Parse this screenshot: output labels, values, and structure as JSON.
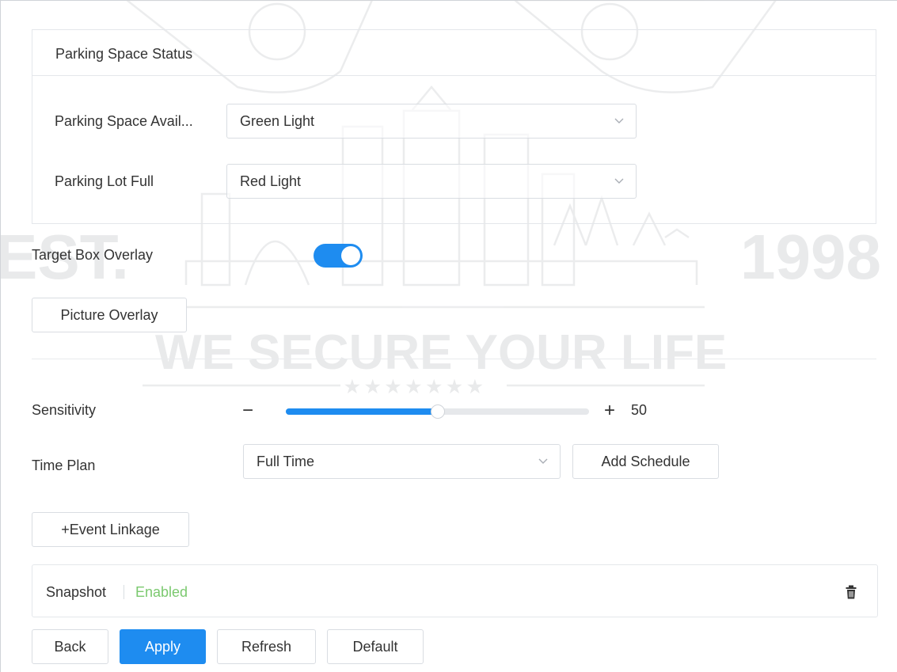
{
  "parking_status": {
    "title": "Parking Space Status",
    "available_label": "Parking Space Avail...",
    "available_value": "Green Light",
    "full_label": "Parking Lot Full",
    "full_value": "Red Light"
  },
  "target_box_overlay": {
    "label": "Target Box Overlay",
    "enabled": true
  },
  "picture_overlay_button": "Picture Overlay",
  "sensitivity": {
    "label": "Sensitivity",
    "minus": "−",
    "plus": "+",
    "value": "50",
    "level": 0.5
  },
  "time_plan": {
    "label": "Time Plan",
    "value": "Full Time",
    "add_schedule": "Add Schedule"
  },
  "event_linkage_button": "+Event Linkage",
  "linkage_item": {
    "name": "Snapshot",
    "status": "Enabled",
    "status_color": "#7bc96f"
  },
  "footer": {
    "back": "Back",
    "apply": "Apply",
    "refresh": "Refresh",
    "default": "Default"
  },
  "watermark": {
    "est": "EST.",
    "year": "1998",
    "slogan": "WE SECURE YOUR LIFE"
  },
  "colors": {
    "accent": "#1e8cf0",
    "enabled_green": "#7bc96f"
  }
}
